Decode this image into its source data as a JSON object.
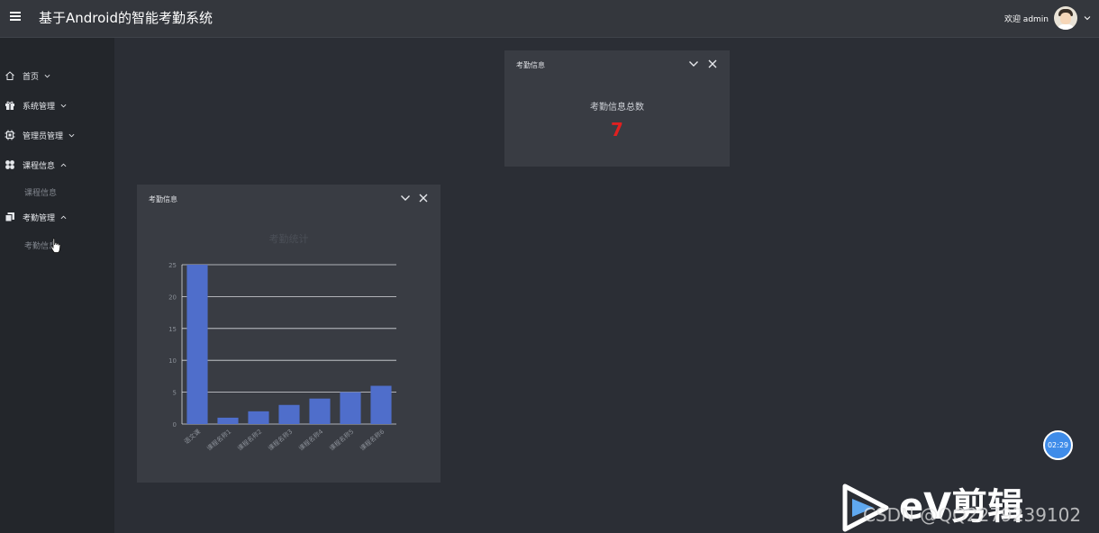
{
  "header": {
    "title": "基于Android的智能考勤系统",
    "welcome": "欢迎 admin"
  },
  "sidebar": {
    "items": [
      {
        "label": "首页",
        "icon": "home-icon",
        "expanded": false
      },
      {
        "label": "系统管理",
        "icon": "gift-icon",
        "expanded": false
      },
      {
        "label": "管理员管理",
        "icon": "chip-icon",
        "expanded": false
      },
      {
        "label": "课程信息",
        "icon": "grid-icon",
        "expanded": true,
        "children": [
          "课程信息"
        ]
      },
      {
        "label": "考勤管理",
        "icon": "copy-icon",
        "expanded": true,
        "children": [
          "考勤信息"
        ]
      }
    ]
  },
  "stat_panel": {
    "title": "考勤信息",
    "label": "考勤信息总数",
    "value": "7"
  },
  "chart_panel": {
    "title": "考勤信息"
  },
  "chart_data": {
    "type": "bar",
    "title": "考勤统计",
    "categories": [
      "语文课",
      "课程名称1",
      "课程名称2",
      "课程名称3",
      "课程名称4",
      "课程名称5",
      "课程名称6"
    ],
    "values": [
      25,
      1,
      2,
      3,
      4,
      5,
      6
    ],
    "ylim": [
      0,
      25
    ],
    "yticks": [
      0,
      5,
      10,
      15,
      20,
      25
    ],
    "grid": true,
    "bar_color": "#4f6ecb"
  },
  "overlay": {
    "timer": "02:29",
    "brand": "eV剪辑",
    "watermark": "CSDN @QQ2279239102"
  },
  "colors": {
    "accent_red": "#e02020",
    "timer_blue": "#3f8ce9"
  }
}
